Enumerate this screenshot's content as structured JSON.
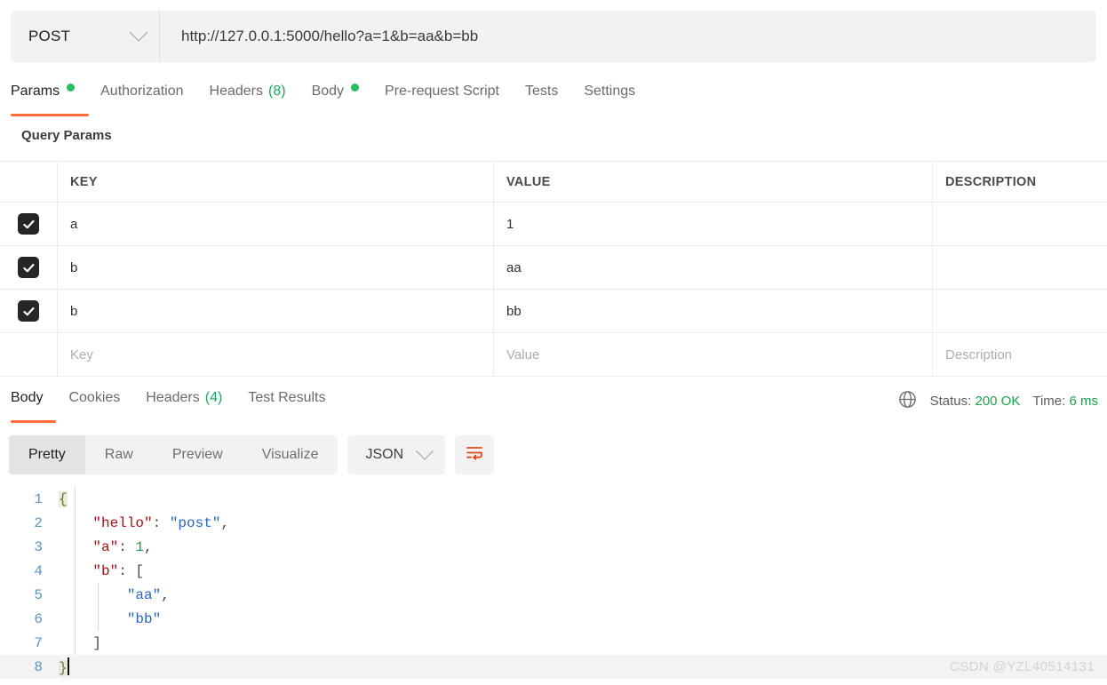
{
  "request": {
    "method": "POST",
    "url": "http://127.0.0.1:5000/hello?a=1&b=aa&b=bb",
    "tabs": [
      {
        "label": "Params",
        "dot": true,
        "count": "",
        "active": true
      },
      {
        "label": "Authorization",
        "dot": false,
        "count": "",
        "active": false
      },
      {
        "label": "Headers",
        "dot": false,
        "count": "(8)",
        "active": false
      },
      {
        "label": "Body",
        "dot": true,
        "count": "",
        "active": false
      },
      {
        "label": "Pre-request Script",
        "dot": false,
        "count": "",
        "active": false
      },
      {
        "label": "Tests",
        "dot": false,
        "count": "",
        "active": false
      },
      {
        "label": "Settings",
        "dot": false,
        "count": "",
        "active": false
      }
    ]
  },
  "params": {
    "section_title": "Query Params",
    "columns": {
      "key": "KEY",
      "value": "VALUE",
      "description": "DESCRIPTION"
    },
    "rows": [
      {
        "checked": true,
        "key": "a",
        "value": "1",
        "description": ""
      },
      {
        "checked": true,
        "key": "b",
        "value": "aa",
        "description": ""
      },
      {
        "checked": true,
        "key": "b",
        "value": "bb",
        "description": ""
      }
    ],
    "placeholder_row": {
      "key": "Key",
      "value": "Value",
      "description": "Description"
    }
  },
  "response": {
    "tabs": [
      {
        "label": "Body",
        "count": "",
        "active": true
      },
      {
        "label": "Cookies",
        "count": "",
        "active": false
      },
      {
        "label": "Headers",
        "count": "(4)",
        "active": false
      },
      {
        "label": "Test Results",
        "count": "",
        "active": false
      }
    ],
    "status_label": "Status:",
    "status_value": "200 OK",
    "time_label": "Time:",
    "time_value": "6 ms",
    "globe_icon": "globe-icon",
    "view_modes": [
      "Pretty",
      "Raw",
      "Preview",
      "Visualize"
    ],
    "active_view_mode": "Pretty",
    "format": "JSON",
    "wrap_icon": "word-wrap-icon",
    "body_lines": [
      {
        "n": "1",
        "segments": [
          {
            "t": "{",
            "c": "brace"
          }
        ]
      },
      {
        "n": "2",
        "segments": [
          {
            "t": "    ",
            "c": "k-pun"
          },
          {
            "t": "\"hello\"",
            "c": "k-key"
          },
          {
            "t": ": ",
            "c": "k-pun"
          },
          {
            "t": "\"post\"",
            "c": "k-str"
          },
          {
            "t": ",",
            "c": "k-pun"
          }
        ]
      },
      {
        "n": "3",
        "segments": [
          {
            "t": "    ",
            "c": "k-pun"
          },
          {
            "t": "\"a\"",
            "c": "k-key"
          },
          {
            "t": ": ",
            "c": "k-pun"
          },
          {
            "t": "1",
            "c": "k-num"
          },
          {
            "t": ",",
            "c": "k-pun"
          }
        ]
      },
      {
        "n": "4",
        "segments": [
          {
            "t": "    ",
            "c": "k-pun"
          },
          {
            "t": "\"b\"",
            "c": "k-key"
          },
          {
            "t": ": ",
            "c": "k-pun"
          },
          {
            "t": "[",
            "c": "k-pun"
          }
        ]
      },
      {
        "n": "5",
        "segments": [
          {
            "t": "        ",
            "c": "k-pun"
          },
          {
            "t": "\"aa\"",
            "c": "k-str"
          },
          {
            "t": ",",
            "c": "k-pun"
          }
        ],
        "guide": true
      },
      {
        "n": "6",
        "segments": [
          {
            "t": "        ",
            "c": "k-pun"
          },
          {
            "t": "\"bb\"",
            "c": "k-str"
          }
        ],
        "guide": true
      },
      {
        "n": "7",
        "segments": [
          {
            "t": "    ",
            "c": "k-pun"
          },
          {
            "t": "]",
            "c": "k-pun"
          }
        ]
      },
      {
        "n": "8",
        "segments": [
          {
            "t": "}",
            "c": "brace"
          }
        ],
        "active": true,
        "cursor": true
      }
    ]
  },
  "watermark": "CSDN @YZL40514131",
  "colors": {
    "accent": "#ff6c37",
    "success": "#21c25e",
    "status_green": "#1aa24c",
    "checkbox": "#262626"
  }
}
